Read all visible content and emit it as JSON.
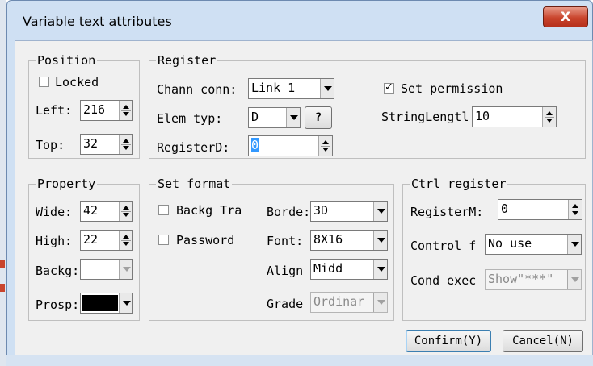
{
  "window": {
    "title": "Variable text attributes",
    "close_label": "X"
  },
  "position": {
    "legend": "Position",
    "locked_label": "Locked",
    "locked_checked": false,
    "left_label": "Left:",
    "left_value": "216",
    "top_label": "Top:",
    "top_value": "32"
  },
  "register": {
    "legend": "Register",
    "chann_label": "Chann conn:",
    "chann_value": "Link 1",
    "elem_label": "Elem typ:",
    "elem_value": "D",
    "question_label": "?",
    "registerd_label": "RegisterD:",
    "registerd_value": "0",
    "set_permission_label": "Set permission",
    "set_permission_checked": true,
    "stringlength_label": "StringLengtl",
    "stringlength_value": "10"
  },
  "property": {
    "legend": "Property",
    "wide_label": "Wide:",
    "wide_value": "42",
    "high_label": "High:",
    "high_value": "22",
    "backg_label": "Backg:",
    "prosp_label": "Prosp:",
    "backg_color": "#ffffff",
    "prosp_color": "#000000"
  },
  "set_format": {
    "legend": "Set format",
    "backg_tra_label": "Backg Tra",
    "password_label": "Password",
    "border_label": "Borde:",
    "border_value": "3D",
    "font_label": "Font:",
    "font_value": "8X16",
    "align_label": "Align",
    "align_value": "Midd",
    "grade_label": "Grade",
    "grade_value": "Ordinar"
  },
  "ctrl_register": {
    "legend": "Ctrl register",
    "registerm_label": "RegisterM:",
    "registerm_value": "0",
    "control_label": "Control f",
    "control_value": "No use",
    "cond_label": "Cond exec",
    "cond_value": "Show\"***\""
  },
  "buttons": {
    "confirm": "Confirm(Y)",
    "cancel": "Cancel(N)"
  },
  "colors": {
    "title_bar": "#cfe0f3",
    "close_button": "#c9442c",
    "dialog_bg": "#f0f0f0",
    "selection": "#3399ff"
  }
}
